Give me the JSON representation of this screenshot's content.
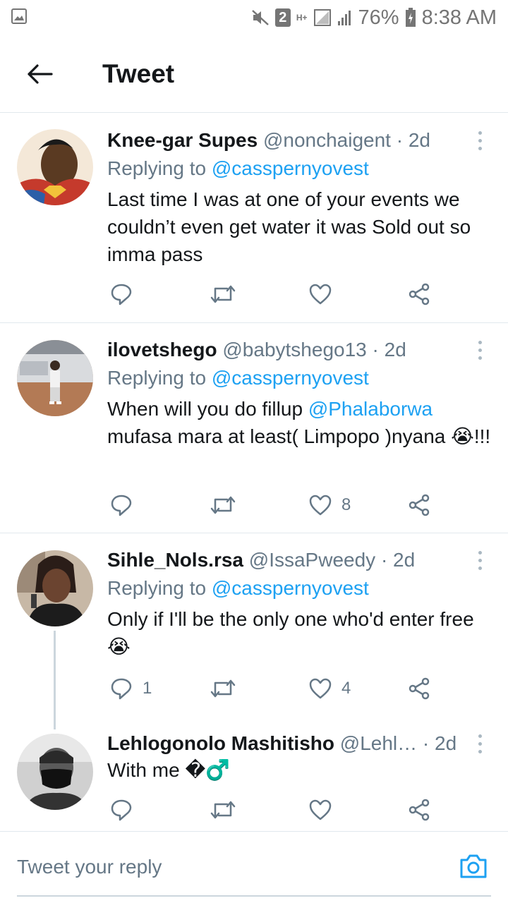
{
  "status_bar": {
    "notification_count": "2",
    "network": "H+",
    "battery": "76%",
    "time": "8:38 AM"
  },
  "header": {
    "title": "Tweet",
    "back_icon": "arrow-left-icon"
  },
  "tweets": [
    {
      "name": "Knee-gar Supes",
      "handle": "@nonchaigent",
      "time": "2d",
      "replying_prefix": "Replying to",
      "replying_to": "@casspernyovest",
      "text": "Last time I was at one of your events we couldn’t even get water it was Sold out so imma pass",
      "reply_count": "",
      "like_count": ""
    },
    {
      "name": "ilovetshego",
      "handle": "@babytshego13",
      "time": "2d",
      "replying_prefix": "Replying to",
      "replying_to": "@casspernyovest",
      "text_part1": "When will you do fillup ",
      "text_mention": "@Phalaborwa",
      "text_part2": " mufasa mara at least( Limpopo )nyana 😭!!!",
      "reply_count": "",
      "like_count": "8"
    },
    {
      "name": "Sihle_Nols.rsa",
      "handle": "@IssaPweedy",
      "time": "2d",
      "replying_prefix": "Replying to",
      "replying_to": "@casspernyovest",
      "text": "Only if I'll be the only one who'd enter free 😭",
      "reply_count": "1",
      "like_count": "4"
    },
    {
      "name": "Lehlogonolo Mashitisho",
      "handle": "@Lehl…",
      "time": "2d",
      "text": "With me �♂️",
      "reply_count": "",
      "like_count": ""
    }
  ],
  "reply_box": {
    "placeholder": "Tweet your reply",
    "camera_icon": "camera-icon"
  },
  "colors": {
    "accent": "#1da1f2",
    "secondary_text": "#657786",
    "divider": "#e1e8ed"
  }
}
